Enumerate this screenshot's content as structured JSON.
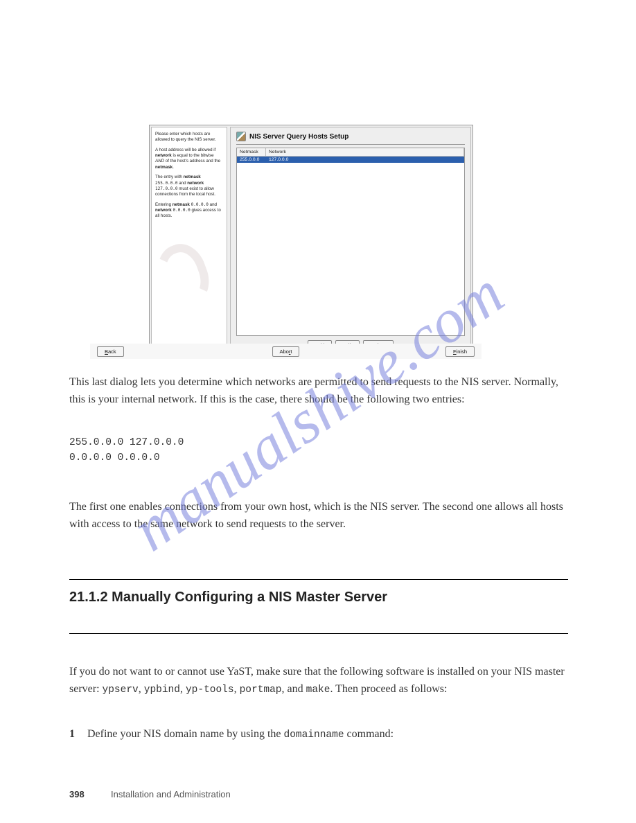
{
  "dialog": {
    "title": "NIS Server Query Hosts Setup",
    "help": {
      "p1_a": "Please enter which hosts are allowed to query the NIS server.",
      "p2_a": "A host address will be allowed if ",
      "p2_b": "network",
      "p2_c": " is equal to the bitwise ",
      "p2_d": "AND",
      "p2_e": " of the host's address and the ",
      "p2_f": "netmask",
      "p2_g": ".",
      "p3_a": "The entry with ",
      "p3_b": "netmask",
      "p3_c": " ",
      "p3_d": "255.0.0.0",
      "p3_e": " and ",
      "p3_f": "network",
      "p3_g": " ",
      "p3_h": "127.0.0.0",
      "p3_i": " must exist to allow connections from the local host.",
      "p4_a": "Entering ",
      "p4_b": "netmask",
      "p4_c": " ",
      "p4_d": "0.0.0.0",
      "p4_e": " and ",
      "p4_f": "network",
      "p4_g": " ",
      "p4_h": "0.0.0.0",
      "p4_i": " gives access to all hosts."
    },
    "table": {
      "col1": "Netmask",
      "col2": "Network",
      "row1_c1": "255.0.0.0",
      "row1_c2": "127.0.0.0"
    },
    "buttons": {
      "add_pre": "A",
      "add_ul": "d",
      "add_post": "d",
      "edit_ul": "E",
      "edit_post": "dit",
      "delete_pre": "De",
      "delete_ul": "l",
      "delete_post": "ete",
      "back_ul": "B",
      "back_post": "ack",
      "abort_pre": "Abo",
      "abort_ul": "r",
      "abort_post": "t",
      "finish_ul": "F",
      "finish_post": "inish"
    }
  },
  "watermark": "manualshive.com",
  "body": {
    "p1": "This last dialog lets you determine which networks are permitted to send requests to the NIS server. Normally, this is your internal network. If this is the case, there should be the following two entries:",
    "code1": "255.0.0.0     127.0.0.0",
    "code2": "0.0.0.0       0.0.0.0",
    "p2": "The first one enables connections from your own host, which is the NIS server. The second one allows all hosts with access to the same network to send requests to the server.",
    "heading3": "21.1.2 Manually Configuring a NIS Master Server",
    "p3_a": "If you do not want to or cannot use YaST, make sure that the following software is installed on your NIS master server: ",
    "p3_b": "ypserv",
    "p3_c": ", ",
    "p3_d": "ypbind",
    "p3_e": ", ",
    "p3_f": "yp-tools",
    "p3_g": ", ",
    "p3_h": "portmap",
    "p3_i": ", and ",
    "p3_j": "make",
    "p3_k": ". Then proceed as follows:",
    "step1_n": "1",
    "step1_a": "Define your NIS domain name by using the ",
    "step1_b": "domainname",
    "step1_c": " command:"
  },
  "footer": {
    "page": "398",
    "text": "Installation and Administration"
  }
}
